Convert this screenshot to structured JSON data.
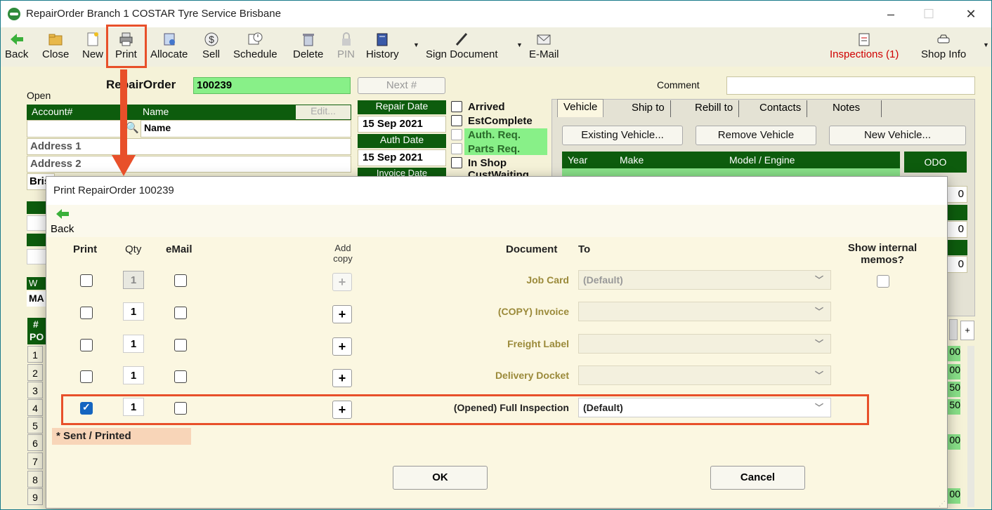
{
  "window": {
    "title": "RepairOrder  Branch 1  COSTAR Tyre Service Brisbane",
    "controls": [
      "–",
      "☐",
      "✕"
    ]
  },
  "toolbar": {
    "back": "Back",
    "close": "Close",
    "new": "New",
    "print": "Print",
    "allocate": "Allocate",
    "sell": "Sell",
    "schedule": "Schedule",
    "delete": "Delete",
    "pin": "PIN",
    "history": "History",
    "sign_document": "Sign Document",
    "email": "E-Mail",
    "inspections": "Inspections (1)",
    "shop_info": "Shop Info"
  },
  "form": {
    "repair_order_label": "RepairOrder",
    "repair_order_number": "100239",
    "next_label": "Next #",
    "comment_label": "Comment",
    "status": "Open",
    "account_label": "Account#",
    "name_label": "Name",
    "edit_label": "Edit...",
    "name_placeholder": "Name",
    "address1": "Address 1",
    "address2": "Address 2",
    "city_partial": "Bris",
    "repair_date_label": "Repair Date",
    "repair_date": "15 Sep 2021",
    "auth_date_label": "Auth Date",
    "auth_date": "15 Sep 2021",
    "invoice_date_label": "Invoice Date",
    "status_flags": [
      "Arrived",
      "EstComplete",
      "Auth. Req.",
      "Parts Req.",
      "In Shop",
      "CustWaiting"
    ],
    "tabs": [
      "Vehicle",
      "Ship to",
      "Rebill to",
      "Contacts",
      "Notes"
    ],
    "vehicle_buttons": [
      "Existing Vehicle...",
      "Remove Vehicle",
      "New Vehicle..."
    ],
    "vehicle_columns": [
      "Year",
      "Make",
      "Model / Engine"
    ],
    "odo_label": "ODO",
    "odo_values": [
      "0",
      "0",
      "0"
    ],
    "left_partials": [
      "W",
      "MA"
    ],
    "grid_header": [
      "#",
      "PO"
    ],
    "row_numbers": [
      "1",
      "2",
      "3",
      "4",
      "5",
      "6",
      "7",
      "8",
      "9"
    ],
    "right_partials": [
      "00",
      "00",
      "50",
      "50",
      "00",
      "00"
    ]
  },
  "dialog": {
    "title": "Print RepairOrder 100239",
    "back": "Back",
    "headers": {
      "print": "Print",
      "qty": "Qty",
      "email": "eMail",
      "add_copy": "Add\ncopy",
      "document": "Document",
      "to": "To",
      "show_memos": "Show internal\nmemos?"
    },
    "rows": [
      {
        "print": false,
        "qty": "1",
        "qty_disabled": true,
        "email": false,
        "add_disabled": true,
        "document": "Job Card",
        "to": "(Default)",
        "active": false
      },
      {
        "print": false,
        "qty": "1",
        "qty_disabled": false,
        "email": false,
        "add_disabled": false,
        "document": "(COPY) Invoice",
        "to": "",
        "active": false
      },
      {
        "print": false,
        "qty": "1",
        "qty_disabled": false,
        "email": false,
        "add_disabled": false,
        "document": "Freight Label",
        "to": "",
        "active": false
      },
      {
        "print": false,
        "qty": "1",
        "qty_disabled": false,
        "email": false,
        "add_disabled": false,
        "document": "Delivery Docket",
        "to": "",
        "active": false
      },
      {
        "print": true,
        "qty": "1",
        "qty_disabled": false,
        "email": false,
        "add_disabled": false,
        "document": "(Opened) Full Inspection",
        "to": "(Default)",
        "active": true
      }
    ],
    "add_label": "+",
    "sent_printed": "* Sent / Printed",
    "ok": "OK",
    "cancel": "Cancel"
  },
  "colors": {
    "accent_orange": "#e8502a",
    "header_green": "#0d5c0d",
    "field_green": "#88f088",
    "checkbox_blue": "#1565c0"
  }
}
